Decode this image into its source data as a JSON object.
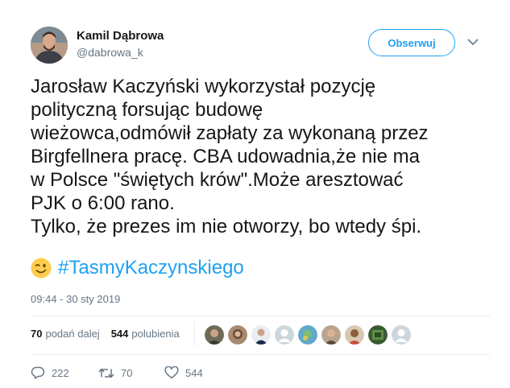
{
  "author": {
    "name": "Kamil Dąbrowa",
    "handle": "@dabrowa_k"
  },
  "follow_button": {
    "label": "Obserwuj"
  },
  "tweet": {
    "lines": [
      "Jarosław Kaczyński wykorzystał pozycję",
      "polityczną forsując budowę",
      "wieżowca,odmówił zapłaty za wykonaną przez",
      "Birgfellnera pracę. CBA udowadnia,że nie ma",
      "w Polsce \"świętych krów\".Może aresztować",
      "PJK o 6:00 rano.",
      "Tylko, że prezes im nie otworzy, bo wtedy śpi."
    ],
    "emoji": "winking-face",
    "hashtag": "#TasmyKaczynskiego",
    "timestamp": "09:44 - 30 sty 2019"
  },
  "stats": {
    "retweets_count": "70",
    "retweets_label": "podań dalej",
    "likes_count": "544",
    "likes_label": "polubienia"
  },
  "actions": {
    "reply_count": "222",
    "retweet_count": "70",
    "like_count": "544"
  },
  "colors": {
    "accent": "#1da1f2",
    "text": "#14171a",
    "muted": "#657786"
  }
}
